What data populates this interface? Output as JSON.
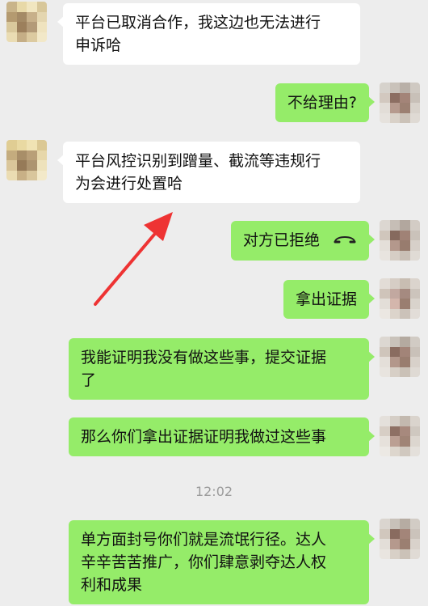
{
  "chat": {
    "messages": [
      {
        "side": "left",
        "text": "平台已取消合作，我这边也无法进行\n申诉哈"
      },
      {
        "side": "right",
        "text": "不给理由?"
      },
      {
        "side": "left",
        "text": "平台风控识别到蹭量、截流等违规行\n为会进行处置哈"
      },
      {
        "side": "right",
        "text": "对方已拒绝",
        "icon": "phone-hangup-icon"
      },
      {
        "side": "right",
        "text": "拿出证据"
      },
      {
        "side": "right",
        "text": "我能证明我没有做这些事，提交证据\n了"
      },
      {
        "side": "right",
        "text": "那么你们拿出证据证明我做过这些事"
      },
      {
        "side": "right",
        "text": "单方面封号你们就是流氓行径。达人\n辛辛苦苦推广，你们肆意剥夺达人权\n利和成果"
      }
    ],
    "timestamp": "12:02"
  },
  "annotation": {
    "icon": "red-arrow-icon",
    "color": "#ee3333"
  },
  "colors": {
    "background": "#ededed",
    "incoming_bubble": "#ffffff",
    "outgoing_bubble": "#95ec69"
  }
}
